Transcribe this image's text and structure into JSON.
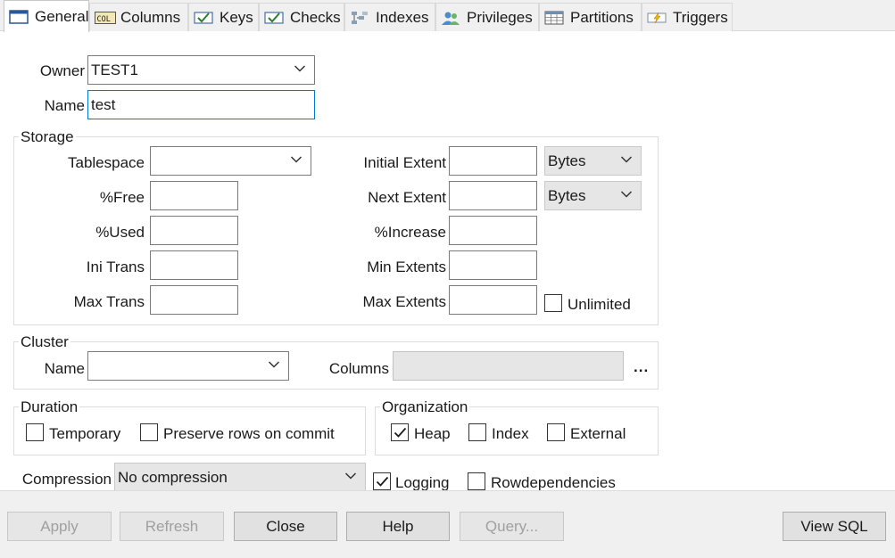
{
  "tabs": [
    {
      "label": "General",
      "icon": "table-icon",
      "active": true
    },
    {
      "label": "Columns",
      "icon": "columns-icon"
    },
    {
      "label": "Keys",
      "icon": "keys-check-icon"
    },
    {
      "label": "Checks",
      "icon": "checks-icon"
    },
    {
      "label": "Indexes",
      "icon": "indexes-icon"
    },
    {
      "label": "Privileges",
      "icon": "users-icon"
    },
    {
      "label": "Partitions",
      "icon": "grid-icon"
    },
    {
      "label": "Triggers",
      "icon": "lightning-icon"
    }
  ],
  "general": {
    "owner_label": "Owner",
    "owner_value": "TEST1",
    "name_label": "Name",
    "name_value": "test"
  },
  "storage": {
    "title": "Storage",
    "tablespace_label": "Tablespace",
    "tablespace_value": "",
    "free_label": "%Free",
    "used_label": "%Used",
    "ini_trans_label": "Ini Trans",
    "max_trans_label": "Max Trans",
    "initial_extent_label": "Initial Extent",
    "initial_extent_unit": "Bytes",
    "next_extent_label": "Next Extent",
    "next_extent_unit": "Bytes",
    "increase_label": "%Increase",
    "min_extents_label": "Min Extents",
    "max_extents_label": "Max Extents",
    "unlimited_label": "Unlimited",
    "unlimited_checked": false
  },
  "cluster": {
    "title": "Cluster",
    "name_label": "Name",
    "columns_label": "Columns",
    "ellipsis": "..."
  },
  "duration": {
    "title": "Duration",
    "temporary_label": "Temporary",
    "temporary_checked": false,
    "preserve_label": "Preserve rows on commit",
    "preserve_checked": false
  },
  "organization": {
    "title": "Organization",
    "heap_label": "Heap",
    "heap_checked": true,
    "index_label": "Index",
    "index_checked": false,
    "external_label": "External",
    "external_checked": false
  },
  "misc": {
    "compression_label": "Compression",
    "compression_value": "No compression",
    "logging_label": "Logging",
    "logging_checked": true,
    "rowdependencies_label": "Rowdependencies",
    "rowdependencies_checked": false
  },
  "buttons": {
    "apply": "Apply",
    "refresh": "Refresh",
    "close": "Close",
    "help": "Help",
    "query": "Query...",
    "view_sql": "View SQL"
  }
}
